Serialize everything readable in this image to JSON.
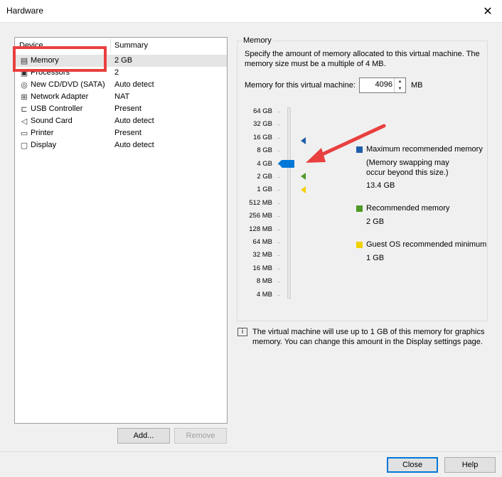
{
  "window": {
    "title": "Hardware",
    "close_glyph": "✕"
  },
  "device_list": {
    "col_device": "Device",
    "col_summary": "Summary",
    "items": [
      {
        "name": "Memory",
        "summary": "2 GB",
        "icon": "memory-icon",
        "glyph": "▤"
      },
      {
        "name": "Processors",
        "summary": "2",
        "icon": "processor-icon",
        "glyph": "▣"
      },
      {
        "name": "New CD/DVD (SATA)",
        "summary": "Auto detect",
        "icon": "cd-dvd-icon",
        "glyph": "◎"
      },
      {
        "name": "Network Adapter",
        "summary": "NAT",
        "icon": "network-adapter-icon",
        "glyph": "⊞"
      },
      {
        "name": "USB Controller",
        "summary": "Present",
        "icon": "usb-icon",
        "glyph": "⊏"
      },
      {
        "name": "Sound Card",
        "summary": "Auto detect",
        "icon": "speaker-icon",
        "glyph": "◁"
      },
      {
        "name": "Printer",
        "summary": "Present",
        "icon": "printer-icon",
        "glyph": "▭"
      },
      {
        "name": "Display",
        "summary": "Auto detect",
        "icon": "monitor-icon",
        "glyph": "▢"
      }
    ],
    "add_label": "Add...",
    "remove_label": "Remove"
  },
  "memory": {
    "group_label": "Memory",
    "description": "Specify the amount of memory allocated to this virtual machine. The memory size must be a multiple of 4 MB.",
    "field_label": "Memory for this virtual machine:",
    "value": "4096",
    "unit": "MB",
    "scale": [
      "64 GB",
      "32 GB",
      "16 GB",
      "8 GB",
      "4 GB",
      "2 GB",
      "1 GB",
      "512 MB",
      "256 MB",
      "128 MB",
      "64 MB",
      "32 MB",
      "16 MB",
      "8 MB",
      "4 MB"
    ],
    "max_recommended_label": "Maximum recommended memory",
    "max_recommended_note": "(Memory swapping may occur beyond this size.)",
    "max_recommended_value": "13.4 GB",
    "recommended_label": "Recommended memory",
    "recommended_value": "2 GB",
    "guest_min_label": "Guest OS recommended minimum",
    "guest_min_value": "1 GB",
    "colors": {
      "max": "#1f5ea8",
      "recommended": "#4e9a26",
      "guest_min": "#f2d100"
    }
  },
  "info": {
    "icon": "info-icon",
    "text": "The virtual machine will use up to 1 GB of this memory for graphics memory. You can change this amount in the Display settings page."
  },
  "footer": {
    "close_label": "Close",
    "help_label": "Help"
  },
  "annotations": {
    "highlight_color": "#e8403f"
  }
}
